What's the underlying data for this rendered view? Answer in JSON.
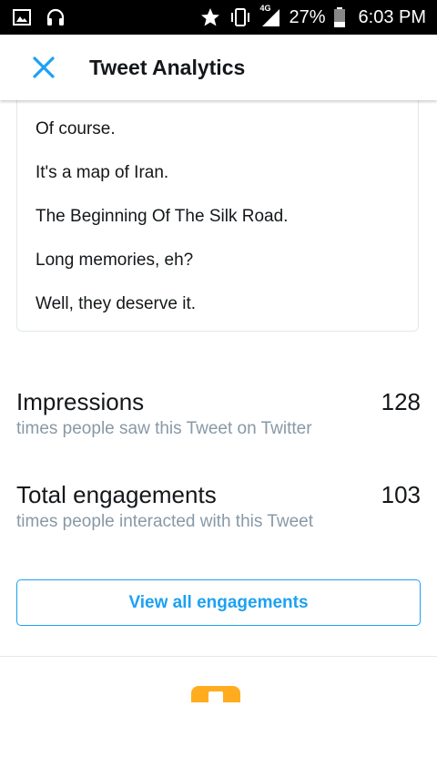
{
  "status_bar": {
    "network_label": "4G",
    "battery": "27%",
    "time": "6:03 PM",
    "icons": [
      "image-icon",
      "headset-icon",
      "star-icon",
      "vibrate-icon",
      "signal-icon",
      "battery-icon"
    ]
  },
  "app_bar": {
    "title": "Tweet Analytics",
    "close_icon": "close-icon"
  },
  "tweet": {
    "lines": [
      "Of course.",
      "It's a map of Iran.",
      "The Beginning Of The Silk Road.",
      "Long memories, eh?",
      "Well, they deserve it."
    ]
  },
  "metrics": {
    "impressions": {
      "title": "Impressions",
      "value": "128",
      "subtitle": "times people saw this Tweet on Twitter"
    },
    "engagements": {
      "title": "Total engagements",
      "value": "103",
      "subtitle": "times people interacted with this Tweet"
    }
  },
  "actions": {
    "view_all_label": "View all engagements"
  },
  "colors": {
    "accent": "#1da1f2",
    "secondary_text": "#8899a6",
    "peek_icon": "#ffad1f"
  }
}
